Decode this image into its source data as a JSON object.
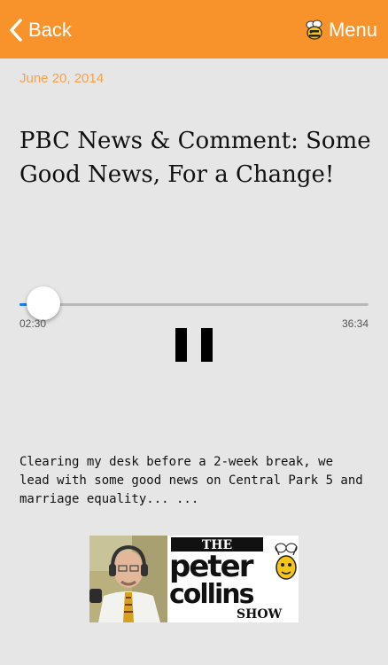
{
  "nav": {
    "back_label": "Back",
    "menu_label": "Menu",
    "bar_color": "#f7932a",
    "back_icon": "chevron-left-icon",
    "menu_icon": "bee-icon"
  },
  "episode": {
    "date": "June 20, 2014",
    "title": "PBC News & Comment: Some Good News, For a Change!",
    "description": "Clearing my desk before a 2-week break, we lead with some good news on Central Park 5 and marriage equality... ..."
  },
  "player": {
    "elapsed": "02:30",
    "total": "36:34",
    "progress_fraction": 0.068,
    "state": "playing",
    "control_icon": "pause-icon",
    "accent": "#1b7cf5"
  },
  "logo": {
    "line1": "THE",
    "line2": "peter",
    "line3": "collins",
    "line4": "SHOW"
  }
}
